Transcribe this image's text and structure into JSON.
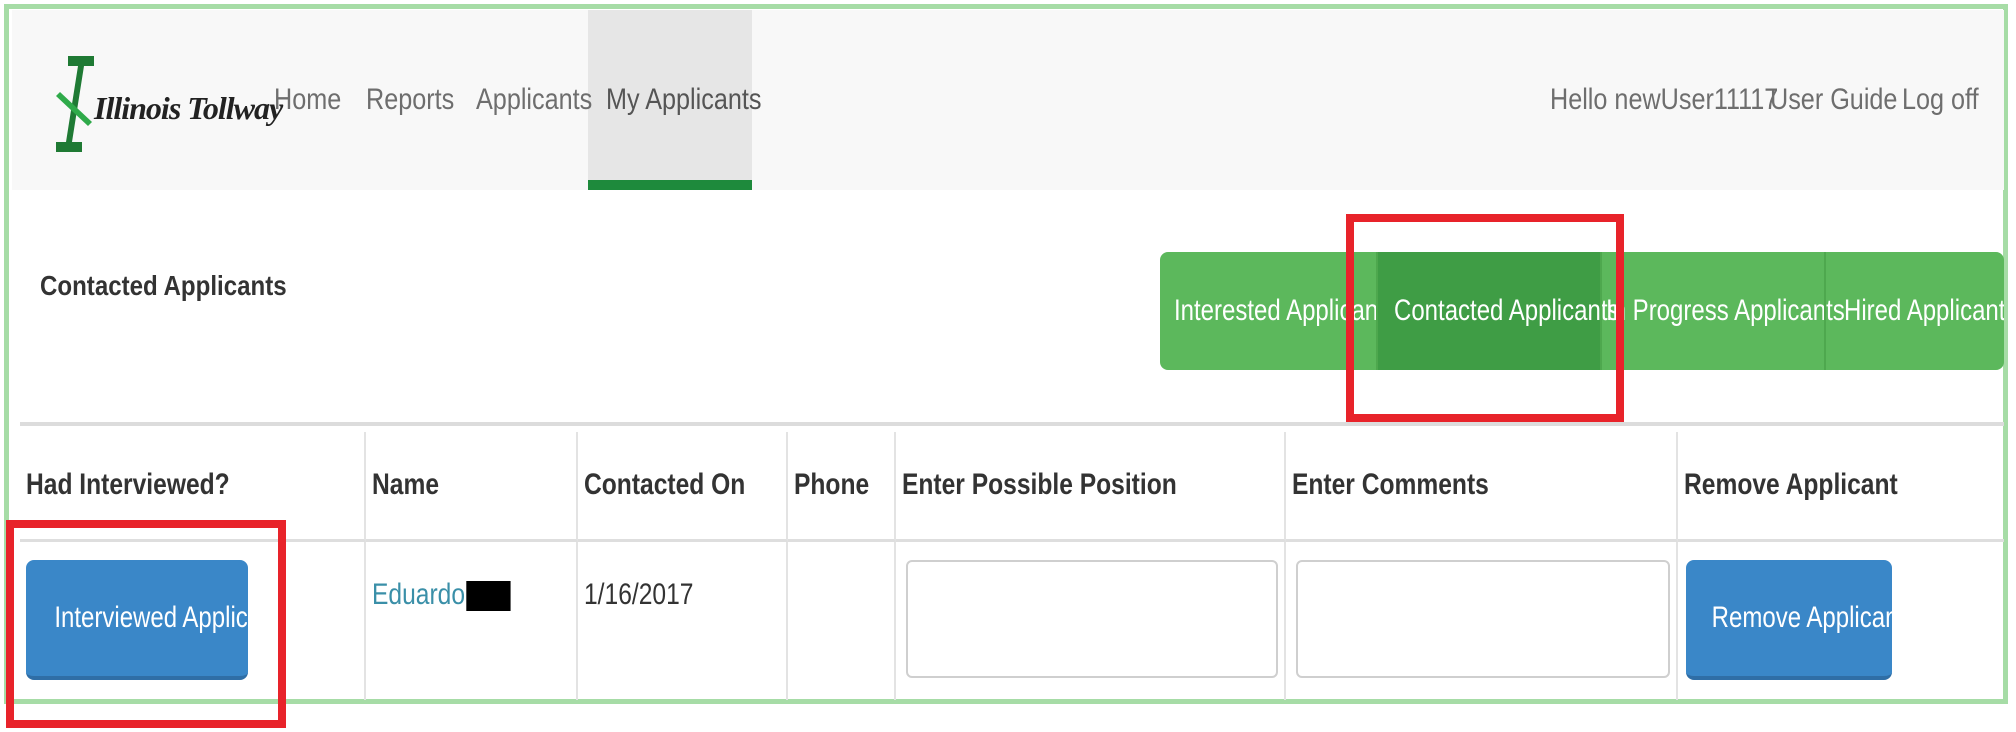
{
  "brand": {
    "name": "Illinois Tollway"
  },
  "nav": {
    "home": "Home",
    "reports": "Reports",
    "applicants": "Applicants",
    "my_applicants": "My Applicants",
    "greeting": "Hello newUser11117",
    "user_guide": "User Guide",
    "logoff": "Log off"
  },
  "section": {
    "title": "Contacted Applicants"
  },
  "filter_tabs": [
    {
      "label": "Interested Applicants",
      "active": false
    },
    {
      "label": "Contacted Applicants",
      "active": true
    },
    {
      "label": "In Progress Applicants",
      "active": false
    },
    {
      "label": "Hired Applicants",
      "active": false
    }
  ],
  "table": {
    "headers": [
      "Had Interviewed?",
      "Name",
      "Contacted On",
      "Phone",
      "Enter Possible Position",
      "Enter Comments",
      "Remove Applicant"
    ],
    "rows": [
      {
        "interview_button": "Interviewed Applicant",
        "name": "Eduardo",
        "contacted_on": "1/16/2017",
        "phone": "",
        "position_value": "",
        "comments_value": "",
        "remove_button": "Remove Applicants"
      }
    ]
  },
  "colors": {
    "accent_green": "#5cb85c",
    "active_green": "#3f9d45",
    "nav_active_bar": "#1e8a3c",
    "primary_blue": "#3a87c8",
    "highlight_red": "#e8232a"
  }
}
